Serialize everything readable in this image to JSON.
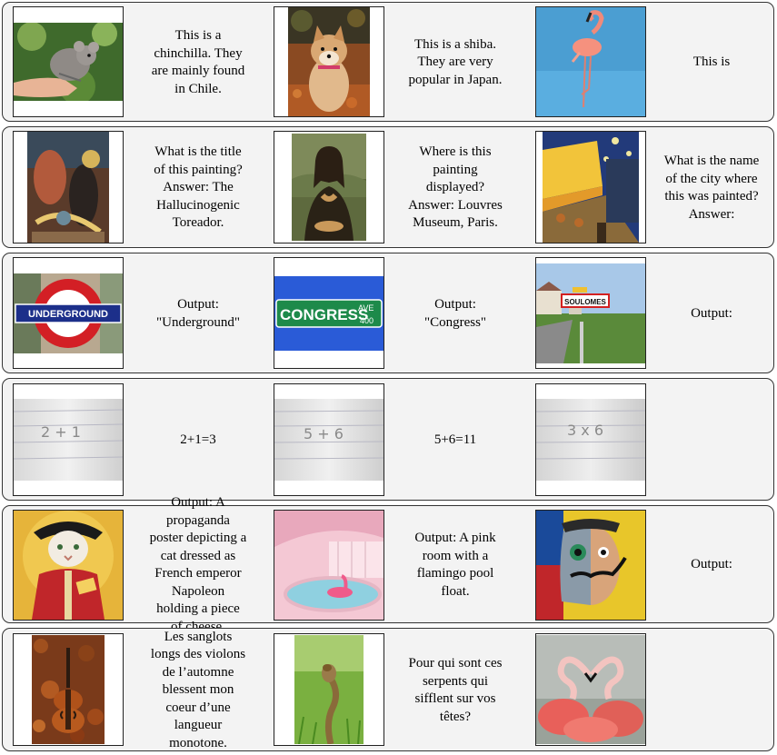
{
  "rows": [
    {
      "items": [
        {
          "image": "chinchilla in hand photo",
          "caption": "This is a\nchinchilla. They\nare mainly found\nin Chile."
        },
        {
          "image": "shiba dog photo",
          "caption": "This is a shiba.\nThey are very\npopular in Japan."
        },
        {
          "image": "flamingo photo",
          "caption": "This is"
        }
      ]
    },
    {
      "items": [
        {
          "image": "surrealist painting",
          "caption": "What is the title\nof this painting?\nAnswer: The\nHallucinogenic\nToreador."
        },
        {
          "image": "mona lisa painting",
          "caption": "Where is this\npainting\ndisplayed?\nAnswer: Louvres\nMuseum, Paris."
        },
        {
          "image": "cafe terrace at night painting",
          "caption": "What is the name\nof the city where\nthis was painted?\nAnswer:"
        }
      ]
    },
    {
      "items": [
        {
          "image": "underground sign photo",
          "caption": "Output:\n\"Underground\"",
          "sign_text": "UNDERGROUND"
        },
        {
          "image": "street sign photo",
          "caption": "Output:\n\"Congress\"",
          "sign_text": "CONGRESS",
          "sign_sub": "AVE",
          "sign_num": "400"
        },
        {
          "image": "town sign photo",
          "caption": "Output:",
          "sign_text": "SOULOMES"
        }
      ]
    },
    {
      "items": [
        {
          "image": "handwritten arithmetic on lined paper",
          "caption": "2+1=3",
          "handwriting": "2 + 1"
        },
        {
          "image": "handwritten arithmetic on lined paper",
          "caption": "5+6=11",
          "handwriting": "5 + 6"
        },
        {
          "image": "handwritten arithmetic on lined paper",
          "caption": "",
          "handwriting": "3 x 6"
        }
      ]
    },
    {
      "items": [
        {
          "image": "propaganda poster cat napoleon",
          "caption": "Output: A\npropaganda\nposter depicting a\ncat dressed as\nFrench emperor\nNapoleon\nholding a piece\nof cheese."
        },
        {
          "image": "pink room with flamingo pool float",
          "caption": "Output: A pink\nroom with a\nflamingo pool\nfloat."
        },
        {
          "image": "split face portrait",
          "caption": "Output:"
        }
      ]
    },
    {
      "items": [
        {
          "image": "violin in autumn leaves photo",
          "caption": "Les sanglots\nlongs des violons\nde l’automne\nblessent mon\ncoeur d’une\nlangueur\nmonotone."
        },
        {
          "image": "cobra in grass photo",
          "caption": "Pour qui sont ces\nserpents qui\nsifflent sur vos\ntêtes?"
        },
        {
          "image": "two flamingos heart photo",
          "caption": ""
        }
      ]
    }
  ]
}
